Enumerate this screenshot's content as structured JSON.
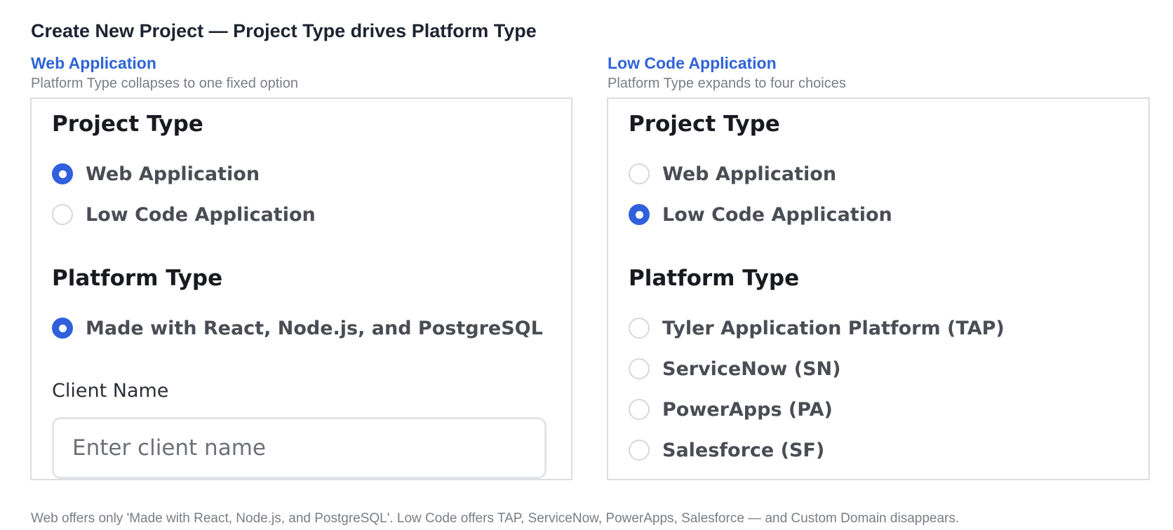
{
  "page": {
    "title": "Create New Project — Project Type drives Platform Type",
    "footnote": "Web offers only 'Made with React, Node.js, and PostgreSQL'. Low Code offers TAP, ServiceNow, PowerApps, Salesforce — and Custom Domain disappears."
  },
  "colors": {
    "accent": "#3060dc",
    "heading_link": "#2f64d6",
    "muted_text": "#7a7d86",
    "panel_border": "#dcdde0"
  },
  "left": {
    "title": "Web Application",
    "subtitle": "Platform Type collapses to one fixed option",
    "project_type": {
      "heading": "Project Type",
      "options": [
        {
          "label": "Web Application",
          "selected": true
        },
        {
          "label": "Low Code Application",
          "selected": false
        }
      ]
    },
    "platform_type": {
      "heading": "Platform Type",
      "options": [
        {
          "label": "Made with React, Node.js, and PostgreSQL",
          "selected": true
        }
      ]
    },
    "client_name": {
      "label": "Client Name",
      "value": "",
      "placeholder": "Enter client name"
    }
  },
  "right": {
    "title": "Low Code Application",
    "subtitle": "Platform Type expands to four choices",
    "project_type": {
      "heading": "Project Type",
      "options": [
        {
          "label": "Web Application",
          "selected": false
        },
        {
          "label": "Low Code Application",
          "selected": true
        }
      ]
    },
    "platform_type": {
      "heading": "Platform Type",
      "options": [
        {
          "label": "Tyler Application Platform (TAP)",
          "selected": false
        },
        {
          "label": "ServiceNow (SN)",
          "selected": false
        },
        {
          "label": "PowerApps (PA)",
          "selected": false
        },
        {
          "label": "Salesforce (SF)",
          "selected": false
        }
      ]
    }
  }
}
